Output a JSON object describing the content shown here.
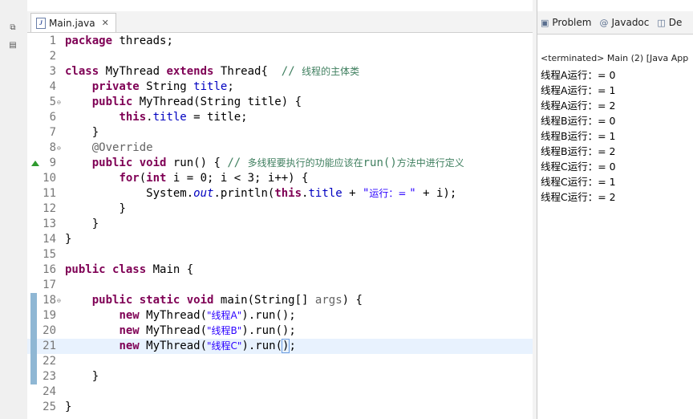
{
  "editor": {
    "tab_label": "Main.java",
    "tab_close": "✕",
    "lines": [
      {
        "n": "1"
      },
      {
        "n": "2"
      },
      {
        "n": "3"
      },
      {
        "n": "4"
      },
      {
        "n": "5"
      },
      {
        "n": "6"
      },
      {
        "n": "7"
      },
      {
        "n": "8"
      },
      {
        "n": "9"
      },
      {
        "n": "10"
      },
      {
        "n": "11"
      },
      {
        "n": "12"
      },
      {
        "n": "13"
      },
      {
        "n": "14"
      },
      {
        "n": "15"
      },
      {
        "n": "16"
      },
      {
        "n": "17"
      },
      {
        "n": "18"
      },
      {
        "n": "19"
      },
      {
        "n": "20"
      },
      {
        "n": "21"
      },
      {
        "n": "22"
      },
      {
        "n": "23"
      },
      {
        "n": "24"
      },
      {
        "n": "25"
      }
    ],
    "code": {
      "l1_kw": "package",
      "l1_rest": " threads;",
      "l3_kw1": "class",
      "l3_name": " MyThread ",
      "l3_kw2": "extends",
      "l3_rest": " Thread{  ",
      "l3_cmt_slash": "// ",
      "l3_cmt": "线程的主体类",
      "l4_kw": "private",
      "l4_type": " String ",
      "l4_fld": "title",
      "l4_end": ";",
      "l5_kw": "public",
      "l5_rest": " MyThread(String title) {",
      "l6_kw": "this",
      "l6_dot": ".",
      "l6_fld": "title",
      "l6_rest": " = title;",
      "l7": "}",
      "l8": "@Override",
      "l9_kw1": "public",
      "l9_kw2": " void",
      "l9_rest": " run() { ",
      "l9_cmt_slash": "// ",
      "l9_cmt1": "多线程要执行的功能应该在",
      "l9_cmt_code": "run()",
      "l9_cmt2": "方法中进行定义",
      "l10_kw1": "for",
      "l10_p": "(",
      "l10_kw2": "int",
      "l10_rest": " i = 0; i < 3; i++) {",
      "l11_a": "System.",
      "l11_out": "out",
      "l11_b": ".println(",
      "l11_kw": "this",
      "l11_dot": ".",
      "l11_fld": "title",
      "l11_c": " + ",
      "l11_q1": "\"",
      "l11_str": "运行：= ",
      "l11_q2": "\"",
      "l11_d": " + i);",
      "l12": "}",
      "l13": "}",
      "l14": "}",
      "l16_kw1": "public",
      "l16_kw2": " class",
      "l16_rest": " Main {",
      "l18_kw1": "public",
      "l18_kw2": " static",
      "l18_kw3": " void",
      "l18_a": " main(String[] ",
      "l18_args": "args",
      "l18_b": ") {",
      "l19_kw": "new",
      "l19_a": " MyThread(",
      "l19_str": "\"线程A\"",
      "l19_b": ").run();",
      "l20_kw": "new",
      "l20_a": " MyThread(",
      "l20_str": "\"线程B\"",
      "l20_b": ").run();",
      "l21_kw": "new",
      "l21_a": " MyThread(",
      "l21_str": "\"线程C\"",
      "l21_b": ").run(",
      "l21_caret": ")",
      "l21_end": ";",
      "l23": "}",
      "l25": "}"
    }
  },
  "console": {
    "tabs": [
      {
        "icon": "problems-icon",
        "label": "Problem"
      },
      {
        "icon": "javadoc-icon",
        "label": "Javadoc"
      },
      {
        "icon": "declaration-icon",
        "label": "De"
      }
    ],
    "status": "<terminated> Main (2) [Java App",
    "output": [
      "线程A运行：= 0",
      "线程A运行：= 1",
      "线程A运行：= 2",
      "线程B运行：= 0",
      "线程B运行：= 1",
      "线程B运行：= 2",
      "线程C运行：= 0",
      "线程C运行：= 1",
      "线程C运行：= 2"
    ]
  },
  "colors": {
    "keyword": "#7f0055",
    "comment": "#3f7f5f",
    "field": "#0000c0",
    "string": "#2a00ff",
    "annotation": "#646464",
    "current_line": "#e8f2fe",
    "gutter_mark": "#8fb7d4"
  }
}
